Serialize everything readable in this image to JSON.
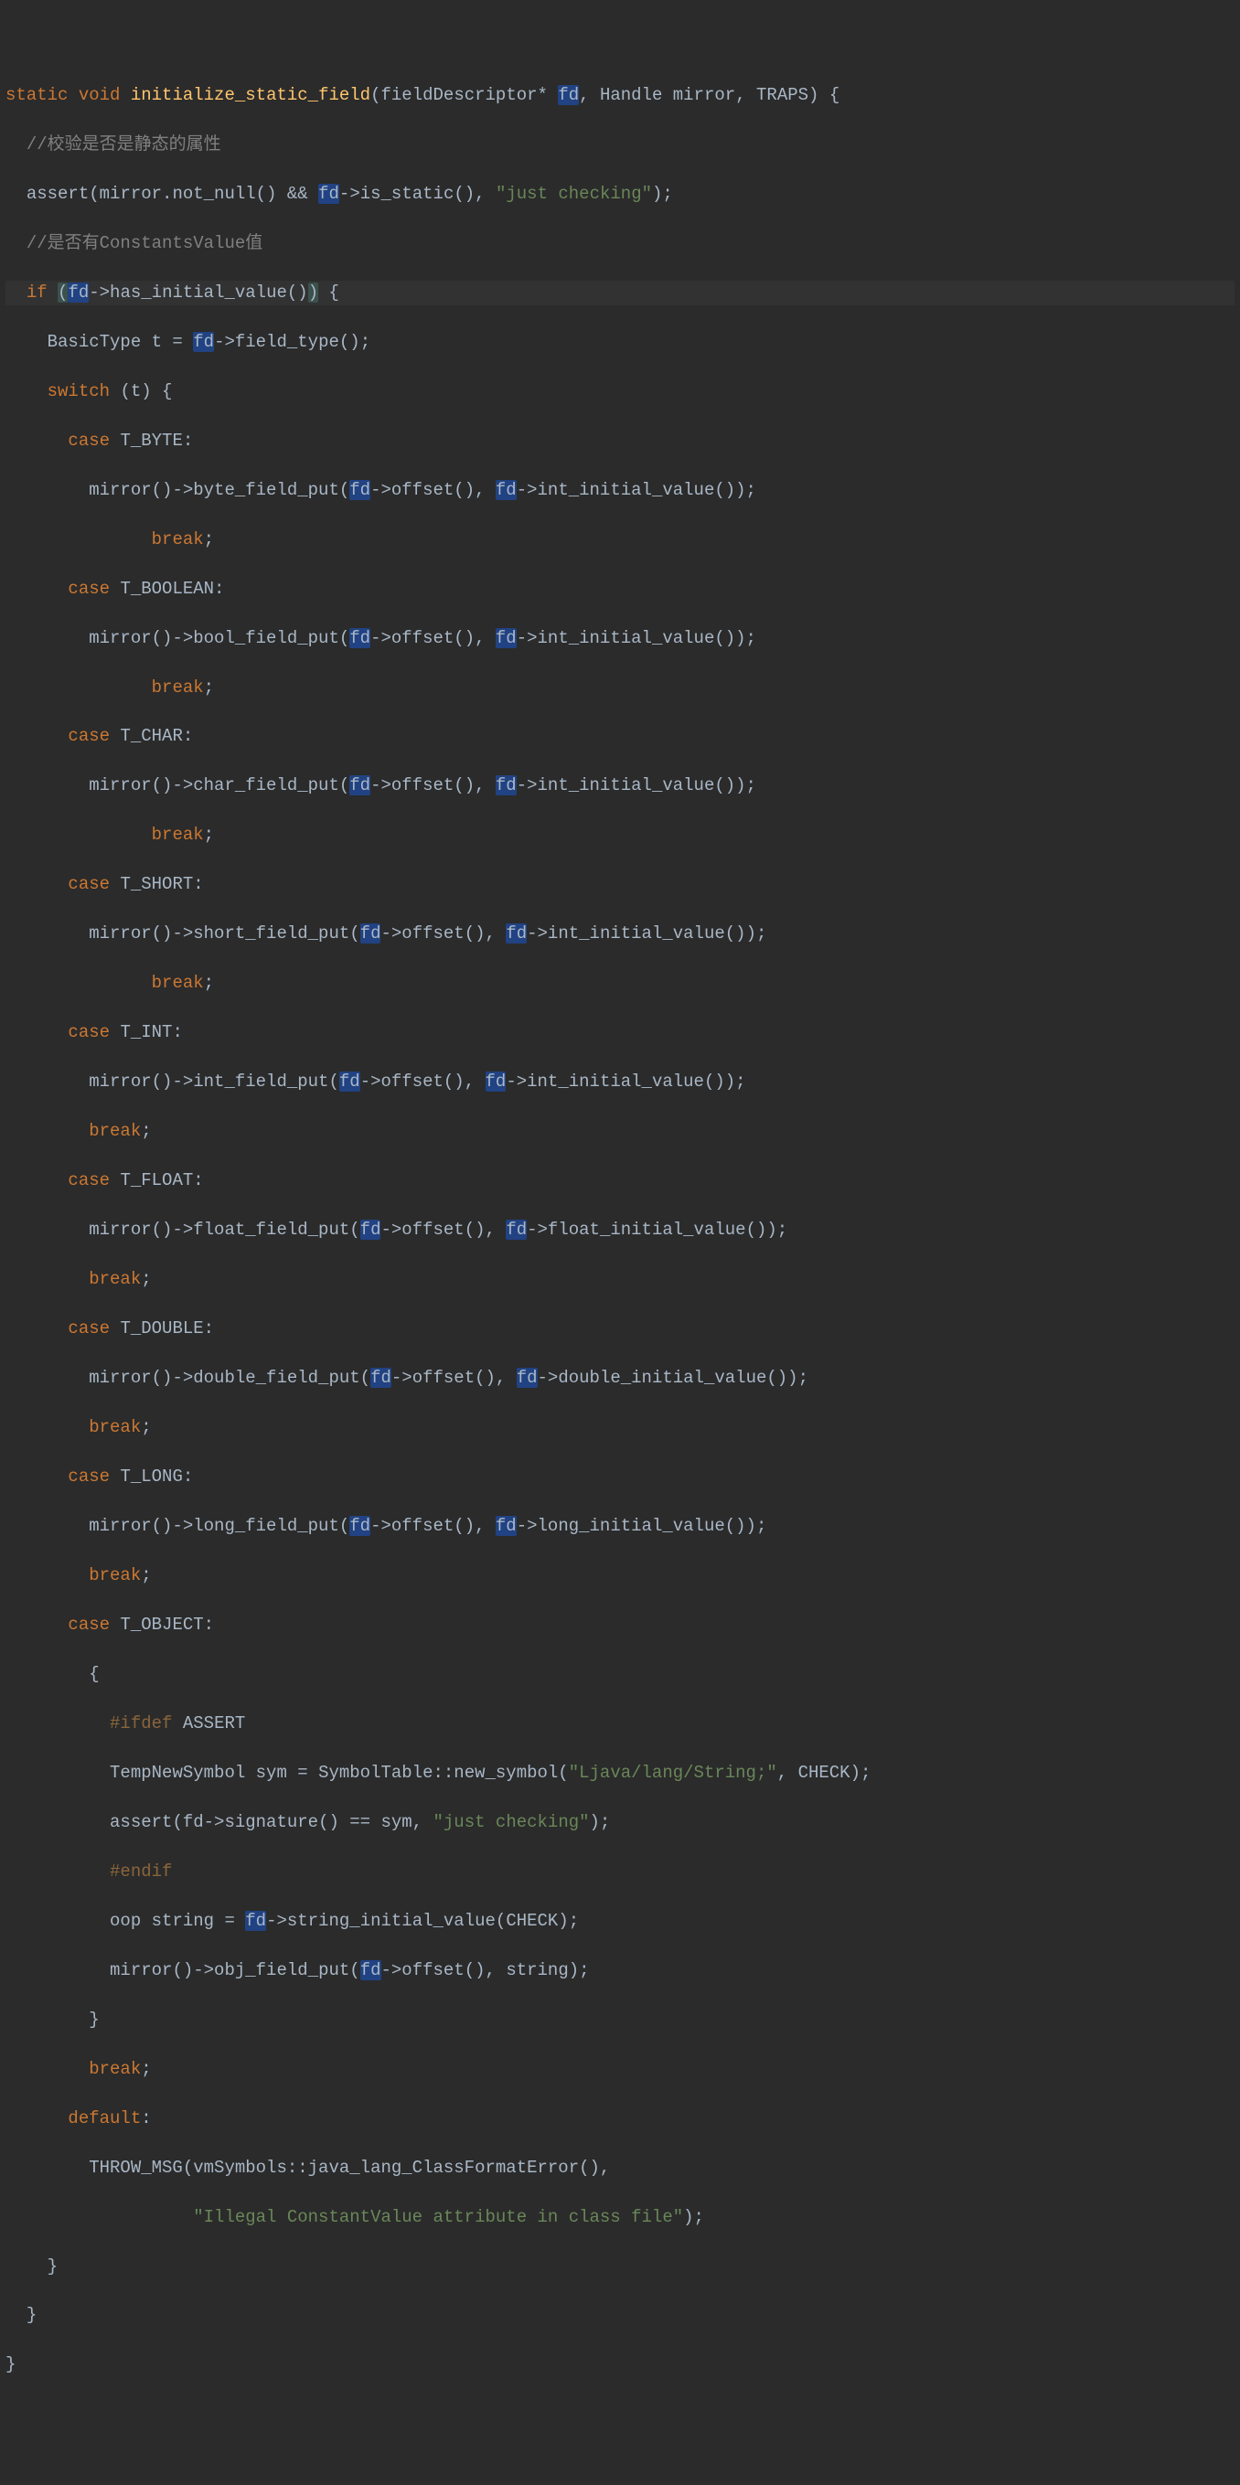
{
  "code": {
    "l1": {
      "kw1": "static",
      "kw2": "void",
      "fn": "initialize_static_field",
      "param1": "fieldDescriptor*",
      "fd": "fd",
      "param2": "Handle mirror",
      "param3": "TRAPS"
    },
    "l2": {
      "cm": "//校验是否是静态的属性"
    },
    "l3": {
      "assert": "assert",
      "mirror": "mirror.not_null()",
      "and": "&&",
      "fd": "fd",
      "arrow": "->is_static()",
      "str": "\"just checking\""
    },
    "l4": {
      "cm": "//是否有ConstantsValue值"
    },
    "l5": {
      "kw": "if",
      "fd": "fd",
      "call": "->has_initial_value()"
    },
    "l6": {
      "t1": "BasicType t =",
      "fd": "fd",
      "t2": "->field_type();"
    },
    "l7": {
      "kw": "switch",
      "arg": "(t) {"
    },
    "l8": {
      "kw": "case",
      "t": "T_BYTE:"
    },
    "l9": {
      "p1": "mirror()->byte_field_put(",
      "fd1": "fd",
      "p2": "->offset(),",
      "fd2": "fd",
      "p3": "->int_initial_value());"
    },
    "l10": {
      "kw": "break",
      ";": ";"
    },
    "l11": {
      "kw": "case",
      "t": "T_BOOLEAN:"
    },
    "l12": {
      "p1": "mirror()->bool_field_put(",
      "fd1": "fd",
      "p2": "->offset(),",
      "fd2": "fd",
      "p3": "->int_initial_value());"
    },
    "l13": {
      "kw": "break",
      ";": ";"
    },
    "l14": {
      "kw": "case",
      "t": "T_CHAR:"
    },
    "l15": {
      "p1": "mirror()->char_field_put(",
      "fd1": "fd",
      "p2": "->offset(),",
      "fd2": "fd",
      "p3": "->int_initial_value());"
    },
    "l16": {
      "kw": "break",
      ";": ";"
    },
    "l17": {
      "kw": "case",
      "t": "T_SHORT:"
    },
    "l18": {
      "p1": "mirror()->short_field_put(",
      "fd1": "fd",
      "p2": "->offset(),",
      "fd2": "fd",
      "p3": "->int_initial_value());"
    },
    "l19": {
      "kw": "break",
      ";": ";"
    },
    "l20": {
      "kw": "case",
      "t": "T_INT:"
    },
    "l21": {
      "p1": "mirror()->int_field_put(",
      "fd1": "fd",
      "p2": "->offset(),",
      "fd2": "fd",
      "p3": "->int_initial_value());"
    },
    "l22": {
      "kw": "break",
      ";": ";"
    },
    "l23": {
      "kw": "case",
      "t": "T_FLOAT:"
    },
    "l24": {
      "p1": "mirror()->float_field_put(",
      "fd1": "fd",
      "p2": "->offset(),",
      "fd2": "fd",
      "p3": "->float_initial_value());"
    },
    "l25": {
      "kw": "break",
      ";": ";"
    },
    "l26": {
      "kw": "case",
      "t": "T_DOUBLE:"
    },
    "l27": {
      "p1": "mirror()->double_field_put(",
      "fd1": "fd",
      "p2": "->offset(),",
      "fd2": "fd",
      "p3": "->double_initial_value());"
    },
    "l28": {
      "kw": "break",
      ";": ";"
    },
    "l29": {
      "kw": "case",
      "t": "T_LONG:"
    },
    "l30": {
      "p1": "mirror()->long_field_put(",
      "fd1": "fd",
      "p2": "->offset(),",
      "fd2": "fd",
      "p3": "->long_initial_value());"
    },
    "l31": {
      "kw": "break",
      ";": ";"
    },
    "l32": {
      "kw": "case",
      "t": "T_OBJECT:"
    },
    "l33": {
      "brace": "{"
    },
    "l34": {
      "pp": "#ifdef",
      "t": "ASSERT"
    },
    "l35": {
      "t": "TempNewSymbol sym = SymbolTable::new_symbol(",
      "str": "\"Ljava/lang/String;\"",
      "t2": ", CHECK);"
    },
    "l36": {
      "t": "assert(fd->signature() == sym, ",
      "str": "\"just checking\"",
      "t2": ");"
    },
    "l37": {
      "pp": "#endif"
    },
    "l38": {
      "t": "oop string = ",
      "fd": "fd",
      "t2": "->string_initial_value(CHECK);"
    },
    "l39": {
      "t": "mirror()->obj_field_put(",
      "fd": "fd",
      "t2": "->offset(), string);"
    },
    "l40": {
      "brace": "}"
    },
    "l41": {
      "kw": "break",
      ";": ";"
    },
    "l42": {
      "kw": "default",
      ":": ":"
    },
    "l43": {
      "t": "THROW_MSG(vmSymbols::java_lang_ClassFormatError(),"
    },
    "l44": {
      "str": "\"Illegal ConstantValue attribute in class file\"",
      "t2": ");"
    },
    "l45": {
      "brace": "}"
    },
    "l46": {
      "brace": "}"
    },
    "l47": {
      "brace": "}"
    }
  }
}
